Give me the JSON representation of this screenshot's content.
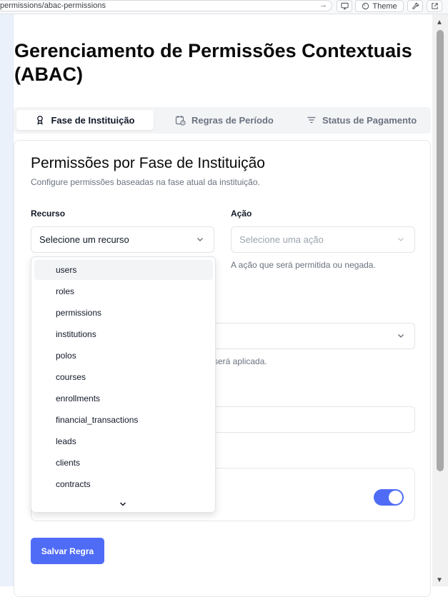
{
  "browser": {
    "url": "permissions/abac-permissions",
    "theme_label": "Theme"
  },
  "page": {
    "title": "Gerenciamento de Permissões Contextuais (ABAC)"
  },
  "tabs": [
    {
      "label": "Fase de Instituição",
      "icon": "award-icon",
      "active": true
    },
    {
      "label": "Regras de Período",
      "icon": "calendar-clock-icon",
      "active": false
    },
    {
      "label": "Status de Pagamento",
      "icon": "filter-icon",
      "active": false
    }
  ],
  "card": {
    "title": "Permissões por Fase de Instituição",
    "description": "Configure permissões baseadas na fase atual da instituição."
  },
  "form": {
    "resource_label": "Recurso",
    "resource_placeholder": "Selecione um recurso",
    "action_label": "Ação",
    "action_placeholder": "Selecione uma ação",
    "action_helper": "A ação que será permitida ou negada.",
    "phase_helper_partial": "será aplicada.",
    "toggle_on": true,
    "save_label": "Salvar Regra"
  },
  "dropdown": {
    "options": [
      "users",
      "roles",
      "permissions",
      "institutions",
      "polos",
      "courses",
      "enrollments",
      "financial_transactions",
      "leads",
      "clients",
      "contracts"
    ],
    "highlighted": "users"
  },
  "colors": {
    "accent": "#4f6cf6",
    "border": "#e2e4e8",
    "muted_text": "#6b7280"
  }
}
